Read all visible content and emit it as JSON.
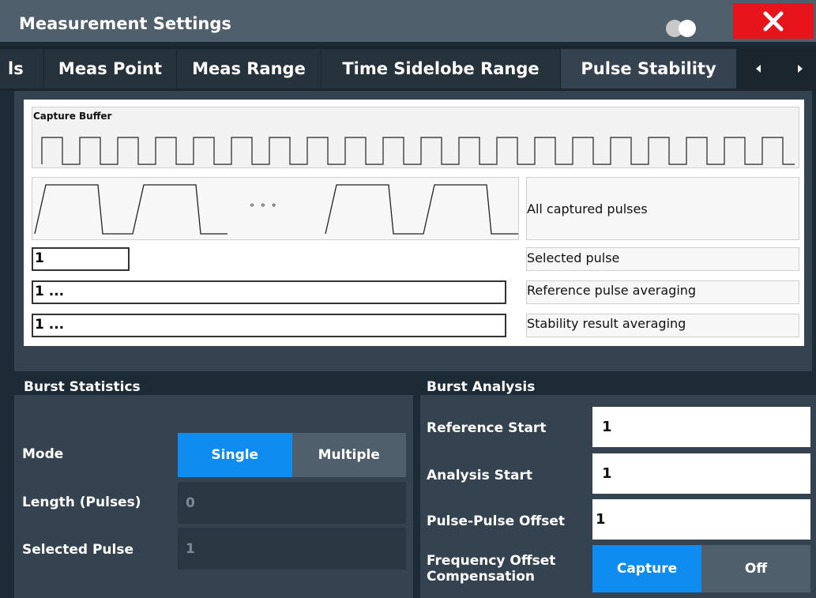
{
  "window": {
    "title": "Measurement Settings",
    "close_glyph": "✕"
  },
  "tabs": [
    {
      "label": "ls",
      "active": false
    },
    {
      "label": "Meas Point",
      "active": false
    },
    {
      "label": "Meas Range",
      "active": false
    },
    {
      "label": "Time Sidelobe Range",
      "active": false
    },
    {
      "label": "Pulse Stability",
      "active": true
    }
  ],
  "tab_arrows": {
    "left": "◂",
    "right": "▸"
  },
  "diagram": {
    "capture_buffer_label": "Capture Buffer",
    "ellipsis": "° ° °",
    "all_pulses_label": "All captured pulses",
    "selected_pulse_label": "Selected pulse",
    "selected_pulse_value": "1",
    "reference_label": "Reference pulse averaging",
    "reference_value": "1 ...",
    "stability_label": "Stability result averaging",
    "stability_value": "1 ..."
  },
  "burst_statistics": {
    "title": "Burst Statistics",
    "mode_label": "Mode",
    "mode_options": [
      "Single",
      "Multiple"
    ],
    "mode_selected": "Single",
    "length_label": "Length (Pulses)",
    "length_value": "0",
    "selected_pulse_label": "Selected Pulse",
    "selected_pulse_value": "1"
  },
  "burst_analysis": {
    "title": "Burst Analysis",
    "reference_start_label": "Reference Start",
    "reference_start_value": "1",
    "analysis_start_label": "Analysis Start",
    "analysis_start_value": "1",
    "pulse_offset_label": "Pulse-Pulse Offset",
    "pulse_offset_value": "1",
    "freq_comp_label_line1": "Frequency Offset",
    "freq_comp_label_line2": "Compensation",
    "freq_comp_options": [
      "Capture",
      "Off"
    ],
    "freq_comp_selected": "Capture"
  },
  "colors": {
    "accent": "#0e8cf0",
    "close": "#e8141c",
    "background": "#1c2b36",
    "panel": "#34434f"
  },
  "icons": {
    "toggle": "toggle-icon",
    "close": "close-icon",
    "scroll_left": "chevron-left-icon",
    "scroll_right": "chevron-right-icon"
  }
}
